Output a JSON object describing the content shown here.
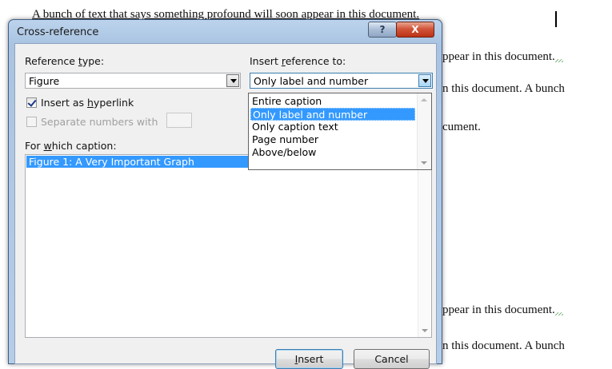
{
  "document": {
    "line1": "A bunch of text that says something profound will soon appear in this document.",
    "lines_right": [
      "ppear in this document.",
      "n this document. A bunch",
      "cument.",
      "ppear in this document.",
      "n this document. A bunch"
    ]
  },
  "dialog": {
    "title": "Cross-reference",
    "help_label": "?",
    "close_label": "X",
    "reference_type": {
      "label_pre": "Reference ",
      "label_ul": "t",
      "label_post": "ype:",
      "value": "Figure"
    },
    "insert_reference_to": {
      "label_pre": "Insert ",
      "label_ul": "r",
      "label_post": "eference to:",
      "value": "Only label and number",
      "options": [
        "Entire caption",
        "Only label and number",
        "Only caption text",
        "Page number",
        "Above/below"
      ],
      "highlighted": "Only label and number"
    },
    "insert_as_hyperlink": {
      "label_pre": "Insert as ",
      "label_ul": "h",
      "label_post": "yperlink",
      "checked": true
    },
    "separate_numbers": {
      "label": "Separate numbers with",
      "checked": false,
      "enabled": false
    },
    "for_which_caption": {
      "label_pre": "For ",
      "label_ul": "w",
      "label_post": "hich caption:",
      "items": [
        "Figure 1: A Very Important Graph"
      ],
      "selected": "Figure 1: A Very Important Graph"
    },
    "insert_button": {
      "label_ul": "I",
      "label_post": "nsert"
    },
    "cancel_button": {
      "label": "Cancel"
    }
  }
}
